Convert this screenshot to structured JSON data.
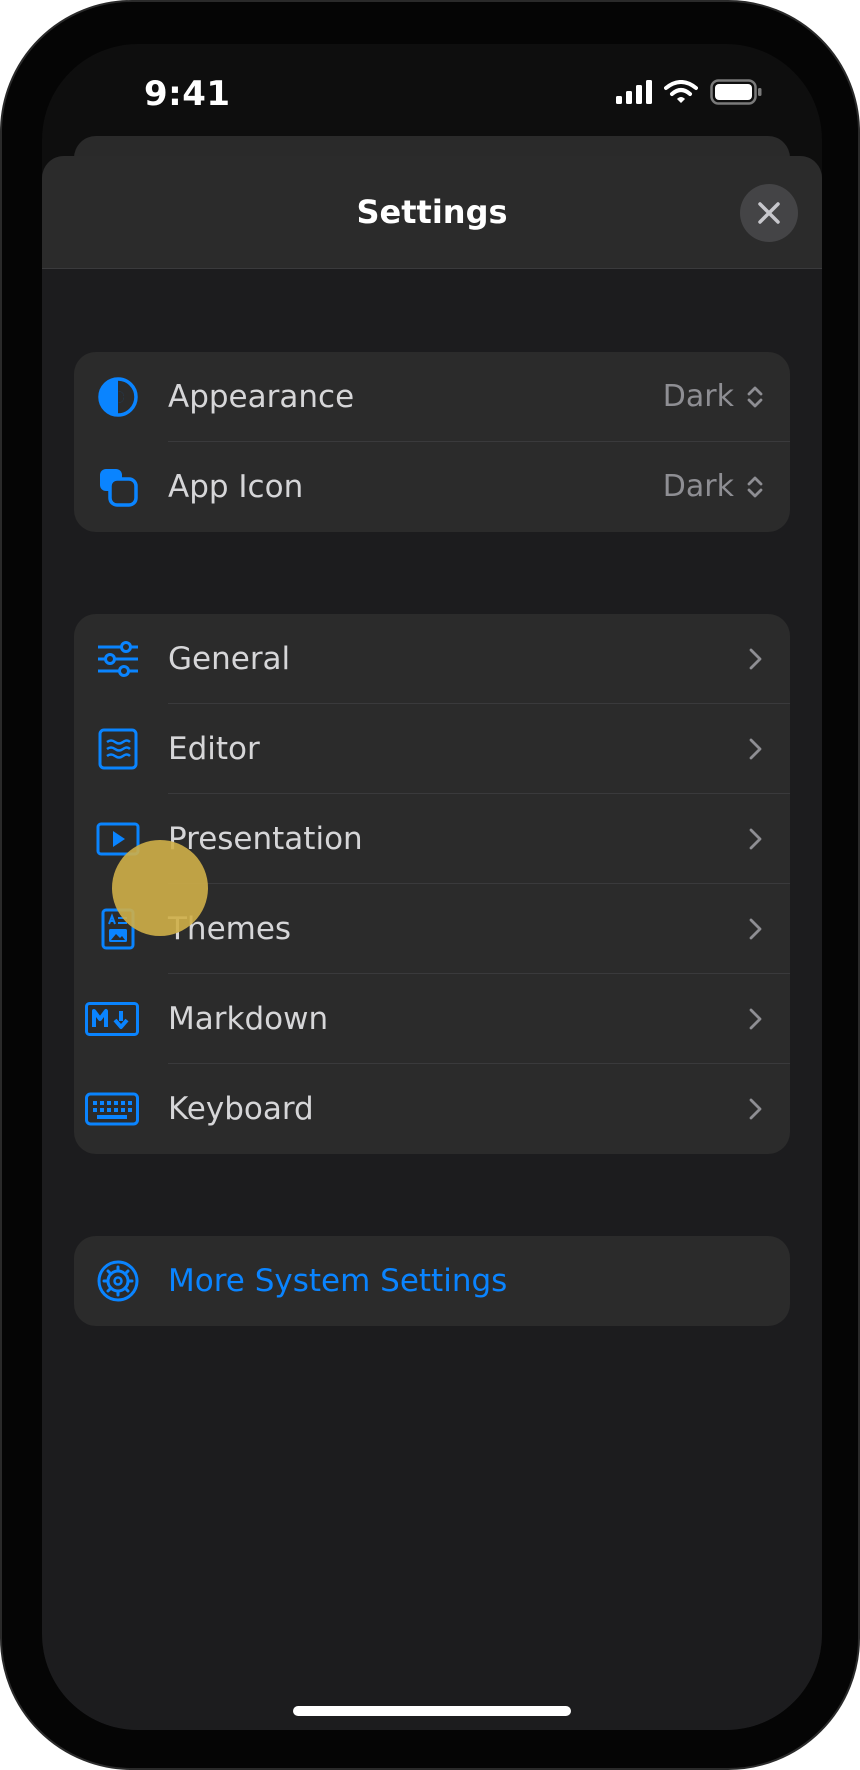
{
  "status_bar": {
    "time": "9:41",
    "icons": [
      "cellular-signal-icon",
      "wifi-icon",
      "battery-icon"
    ]
  },
  "sheet": {
    "title": "Settings",
    "close_icon": "close-icon"
  },
  "groups": {
    "display": [
      {
        "label": "Appearance",
        "value": "Dark",
        "icon": "appearance-icon"
      },
      {
        "label": "App Icon",
        "value": "Dark",
        "icon": "app-icon-icon"
      }
    ],
    "sections": [
      {
        "label": "General",
        "icon": "sliders-icon"
      },
      {
        "label": "Editor",
        "icon": "editor-icon"
      },
      {
        "label": "Presentation",
        "icon": "play-icon"
      },
      {
        "label": "Themes",
        "icon": "themes-icon"
      },
      {
        "label": "Markdown",
        "icon": "markdown-icon"
      },
      {
        "label": "Keyboard",
        "icon": "keyboard-icon"
      }
    ],
    "system": {
      "label": "More System Settings",
      "icon": "gear-icon"
    }
  },
  "colors": {
    "accent": "#0a84ff",
    "sheet_background": "#1c1c1e",
    "group_background": "#2b2b2b",
    "touch_indicator": "#cfaf48"
  }
}
